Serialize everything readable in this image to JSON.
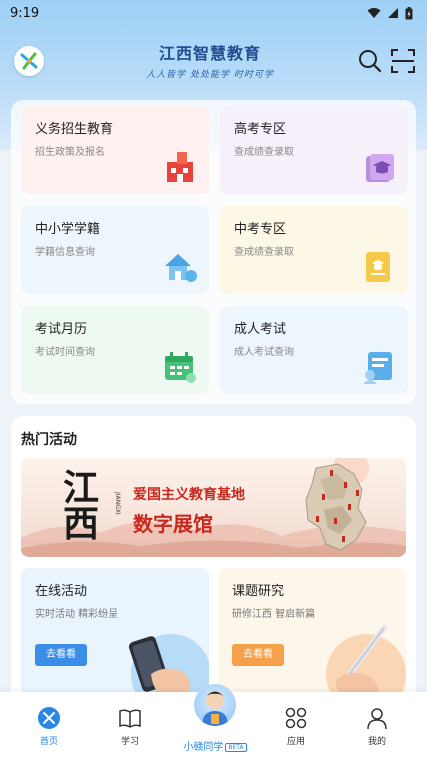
{
  "status_bar": {
    "time": "9:19"
  },
  "header": {
    "title": "江西智慧教育",
    "slogan": "人人皆学 处处能学 时时可学"
  },
  "services": [
    {
      "title": "义务招生教育",
      "subtitle": "招生政策及报名",
      "icon": "school-building-icon",
      "bg": "#fff1f0"
    },
    {
      "title": "高考专区",
      "subtitle": "查成绩查录取",
      "icon": "graduation-book-icon",
      "bg": "#f6f0fb"
    },
    {
      "title": "中小学学籍",
      "subtitle": "学籍信息查询",
      "icon": "house-icon",
      "bg": "#eef6fd"
    },
    {
      "title": "中考专区",
      "subtitle": "查成绩查录取",
      "icon": "certificate-icon",
      "bg": "#fdf7e6"
    },
    {
      "title": "考试月历",
      "subtitle": "考试时间查询",
      "icon": "calendar-icon",
      "bg": "#eefaf1"
    },
    {
      "title": "成人考试",
      "subtitle": "成人考试查询",
      "icon": "id-card-icon",
      "bg": "#eef6fd"
    }
  ],
  "hot": {
    "title": "热门活动",
    "banner": {
      "calligraphy": "江西",
      "pinyin": "JIANGXI",
      "line1": "爱国主义教育基地",
      "line2": "数字展馆"
    },
    "activities": [
      {
        "title": "在线活动",
        "subtitle": "实时活动 精彩纷呈",
        "button": "去看看",
        "btn_color": "#3b8ee8",
        "bg": "#eaf4fd"
      },
      {
        "title": "课题研究",
        "subtitle": "研修江西 智启新篇",
        "button": "去看看",
        "btn_color": "#f5a04a",
        "bg": "#fdf6ea"
      }
    ]
  },
  "nav": {
    "items": [
      {
        "label": "首页",
        "active": true
      },
      {
        "label": "学习",
        "active": false
      },
      {
        "label": "应用",
        "active": false
      },
      {
        "label": "我的",
        "active": false
      }
    ],
    "assistant_label": "小赣同学",
    "assistant_badge": "BETA"
  },
  "colors": {
    "accent": "#2a86e6",
    "brand": "#1f4d8f",
    "banner_red": "#c8281e"
  }
}
